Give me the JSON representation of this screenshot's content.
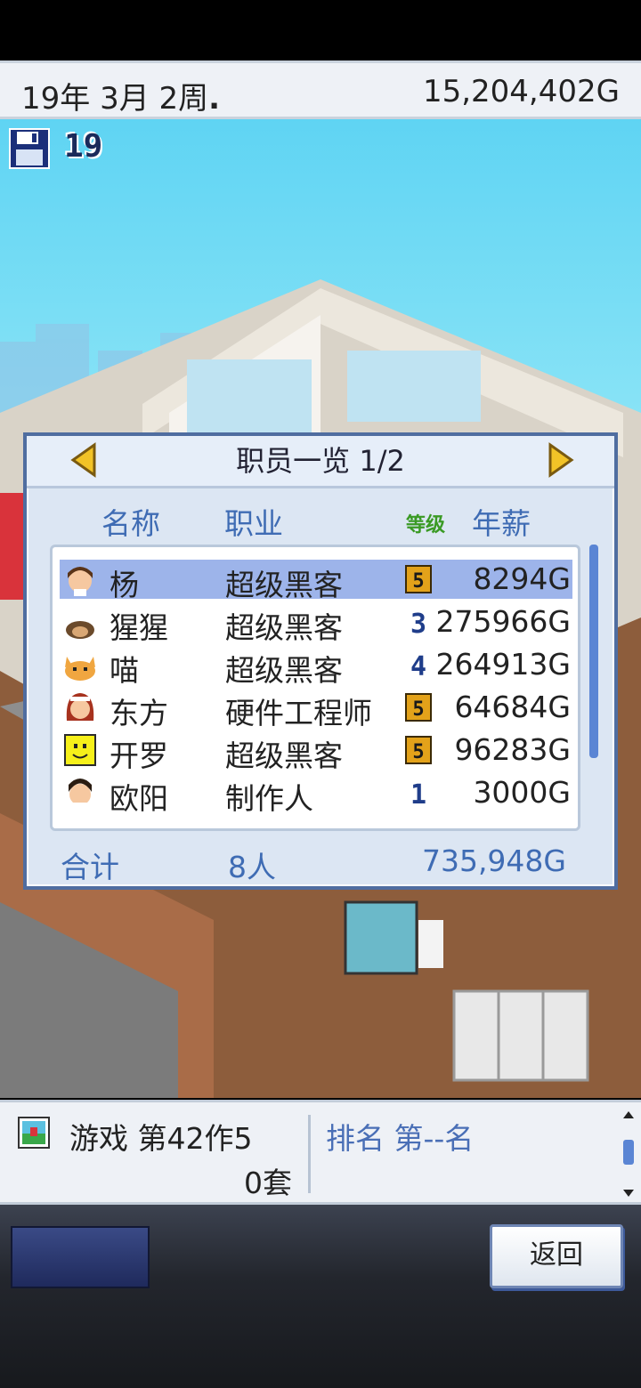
{
  "status": {
    "date": "19年 3月 2周",
    "date_marker": ".",
    "money": "15,204,402G",
    "save_count": "19"
  },
  "panel": {
    "title": "职员一览 1/2",
    "headers": {
      "name": "名称",
      "job": "职业",
      "level": "等级",
      "salary": "年薪"
    },
    "rows": [
      {
        "name": "杨",
        "job": "超级黑客",
        "level": "5",
        "salary": "8294G",
        "selected": true,
        "avatar": "male-brown-hair-avatar"
      },
      {
        "name": "猩猩",
        "job": "超级黑客",
        "level": "3",
        "salary": "275966G",
        "selected": false,
        "avatar": "gorilla-avatar"
      },
      {
        "name": "喵",
        "job": "超级黑客",
        "level": "4",
        "salary": "264913G",
        "selected": false,
        "avatar": "cat-avatar"
      },
      {
        "name": "东方",
        "job": "硬件工程师",
        "level": "5",
        "salary": "64684G",
        "selected": false,
        "avatar": "female-red-hair-avatar"
      },
      {
        "name": "开罗",
        "job": "超级黑客",
        "level": "5",
        "salary": "96283G",
        "selected": false,
        "avatar": "yellow-smiley-avatar"
      },
      {
        "name": "欧阳",
        "job": "制作人",
        "level": "1",
        "salary": "3000G",
        "selected": false,
        "avatar": "male-dark-hair-avatar"
      }
    ],
    "total": {
      "label": "合计",
      "count": "8人",
      "salary": "735,948G"
    }
  },
  "info": {
    "game_title": "游戏 第42作5",
    "sales": "0套",
    "rank": "排名 第--名"
  },
  "buttons": {
    "back": "返回"
  },
  "colors": {
    "accent_blue": "#3f6cb4",
    "selected_row": "#9db4ea",
    "level_gold": "#e3a21a"
  }
}
